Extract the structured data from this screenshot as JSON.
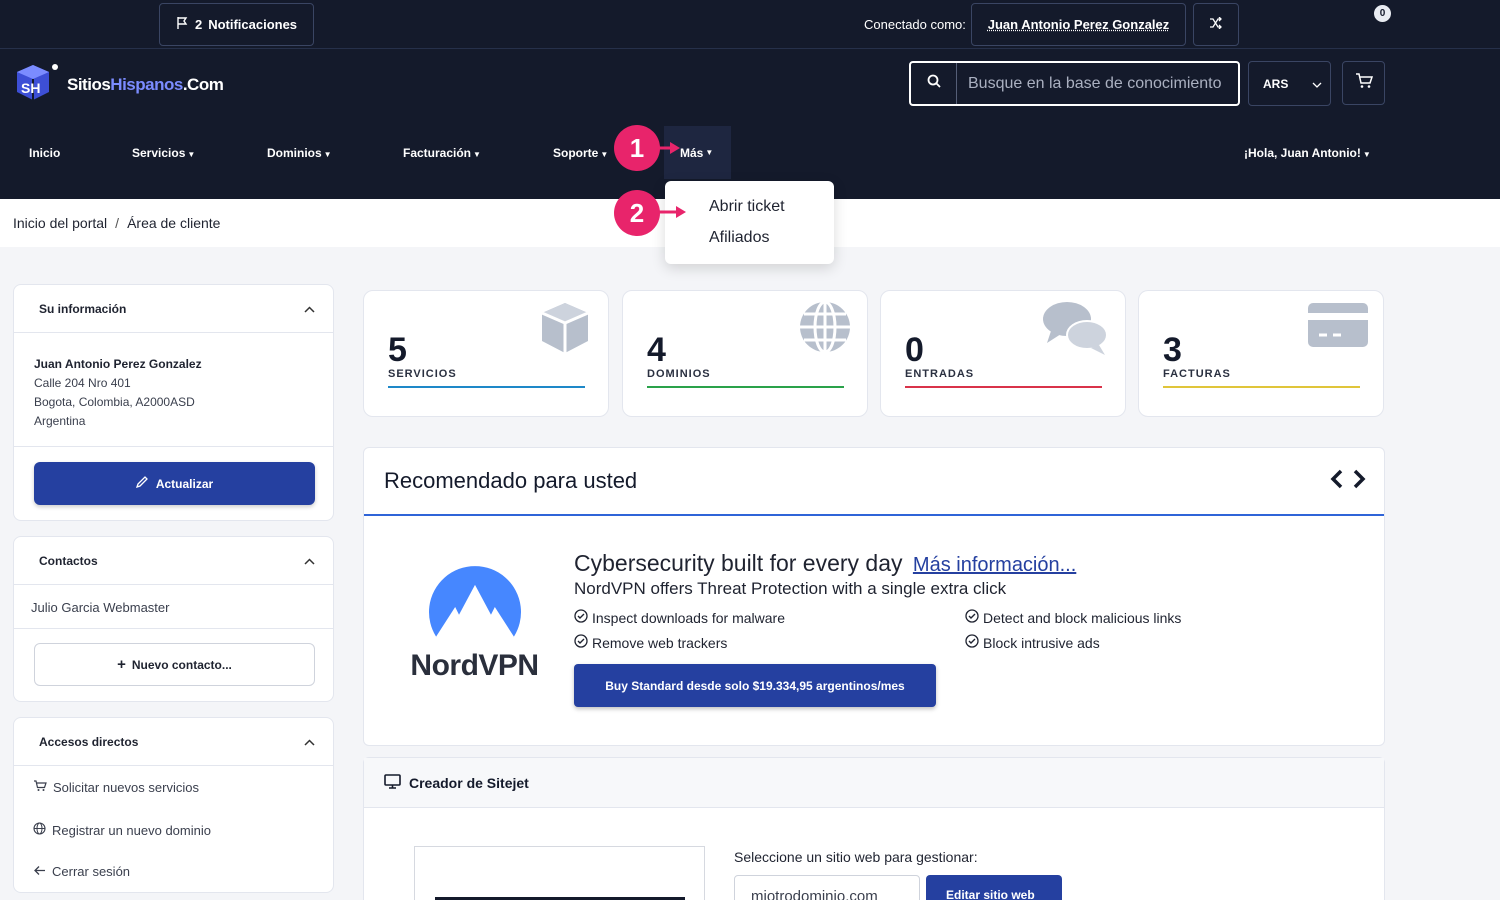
{
  "topbar": {
    "notifications_count": "2",
    "notifications_label": "Notificaciones",
    "connected_label": "Conectado como:",
    "user_name": "Juan Antonio Perez Gonzalez"
  },
  "header": {
    "logo_part1": "Sitios",
    "logo_part2": "Hispanos",
    "logo_part3": ".Com",
    "search_placeholder": "Busque en la base de conocimiento",
    "currency": "ARS",
    "cart_count": "0"
  },
  "nav": {
    "inicio": "Inicio",
    "servicios": "Servicios",
    "dominios": "Dominios",
    "facturacion": "Facturación",
    "soporte": "Soporte",
    "mas": "Más",
    "greeting": "¡Hola, Juan Antonio!"
  },
  "dropdown": {
    "items": [
      "Abrir ticket",
      "Afiliados"
    ]
  },
  "callouts": [
    "1",
    "2"
  ],
  "breadcrumb": {
    "home": "Inicio del portal",
    "sep": "/",
    "current": "Área de cliente"
  },
  "sidebar": {
    "info": {
      "title": "Su información",
      "name": "Juan Antonio Perez Gonzalez",
      "address1": "Calle 204 Nro 401",
      "address2": "Bogota, Colombia, A2000ASD",
      "country": "Argentina",
      "update_label": "Actualizar"
    },
    "contacts": {
      "title": "Contactos",
      "contact": "Julio Garcia Webmaster",
      "new_contact": "Nuevo contacto..."
    },
    "shortcuts": {
      "title": "Accesos directos",
      "items": [
        "Solicitar nuevos servicios",
        "Registrar un nuevo dominio",
        "Cerrar sesión"
      ]
    }
  },
  "stats": [
    {
      "value": "5",
      "label": "SERVICIOS",
      "color": "#1e88c8"
    },
    {
      "value": "4",
      "label": "DOMINIOS",
      "color": "#2aa24a"
    },
    {
      "value": "0",
      "label": "ENTRADAS",
      "color": "#d9334a"
    },
    {
      "value": "3",
      "label": "FACTURAS",
      "color": "#e0c53a"
    }
  ],
  "recommended": {
    "title": "Recomendado para usted",
    "brand": "NordVPN",
    "headline": "Cybersecurity built for every day",
    "more_link": "Más información...",
    "subtitle": "NordVPN offers Threat Protection with a single extra click",
    "features": [
      "Inspect downloads for malware",
      "Detect and block malicious links",
      "Remove web trackers",
      "Block intrusive ads"
    ],
    "buy_label": "Buy Standard desde solo $19.334,95 argentinos/mes"
  },
  "sitejet": {
    "title": "Creador de Sitejet",
    "select_label": "Seleccione un sitio web para gestionar:",
    "selected_site": "miotrodominio.com",
    "edit_label": "Editar sitio web"
  },
  "colors": {
    "dark_bg": "#141a2b",
    "primary": "#2540a0",
    "callout": "#e8246b",
    "accent_line": "#2f64d8"
  }
}
